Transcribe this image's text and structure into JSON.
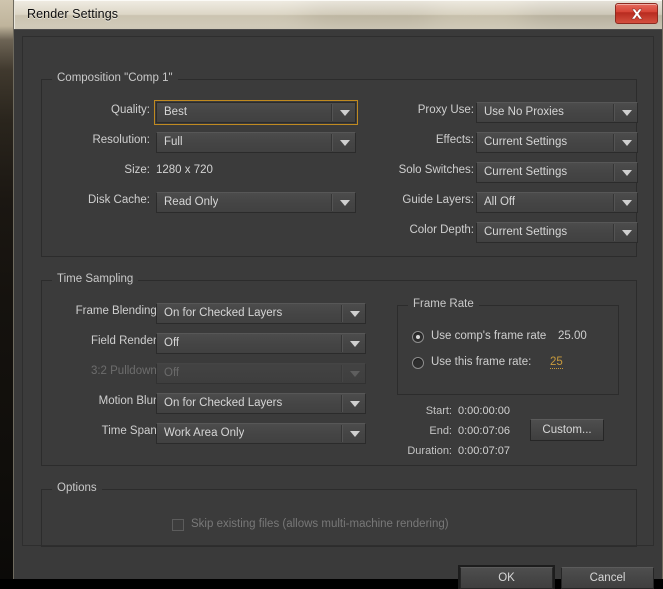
{
  "window": {
    "title": "Render Settings",
    "close_icon": "close-icon"
  },
  "composition": {
    "group_title": "Composition \"Comp 1\"",
    "left_fields": [
      {
        "label": "Quality:",
        "value": "Best",
        "focused": true,
        "disabled": false
      },
      {
        "label": "Resolution:",
        "value": "Full",
        "focused": false,
        "disabled": false
      },
      {
        "label": "Disk Cache:",
        "value": "Read Only",
        "focused": false,
        "disabled": false
      }
    ],
    "size": {
      "label": "Size:",
      "value": "1280 x 720"
    },
    "right_fields": [
      {
        "label": "Proxy Use:",
        "value": "Use No Proxies",
        "disabled": false
      },
      {
        "label": "Effects:",
        "value": "Current Settings",
        "disabled": false
      },
      {
        "label": "Solo Switches:",
        "value": "Current Settings",
        "disabled": false
      },
      {
        "label": "Guide Layers:",
        "value": "All Off",
        "disabled": false
      },
      {
        "label": "Color Depth:",
        "value": "Current Settings",
        "disabled": false
      }
    ]
  },
  "time_sampling": {
    "group_title": "Time Sampling",
    "fields": [
      {
        "label": "Frame Blending:",
        "value": "On for Checked Layers",
        "disabled": false
      },
      {
        "label": "Field Render:",
        "value": "Off",
        "disabled": false
      },
      {
        "label": "3:2 Pulldown:",
        "value": "Off",
        "disabled": true
      },
      {
        "label": "Motion Blur:",
        "value": "On for Checked Layers",
        "disabled": false
      },
      {
        "label": "Time Span:",
        "value": "Work Area Only",
        "disabled": false
      }
    ]
  },
  "frame_rate": {
    "group_title": "Frame Rate",
    "use_comp": {
      "label": "Use comp's frame rate",
      "value": "25.00",
      "selected": true
    },
    "use_this": {
      "label": "Use this frame rate:",
      "value": "25",
      "selected": false
    }
  },
  "time_info": {
    "start_label": "Start:",
    "start_value": "0:00:00:00",
    "end_label": "End:",
    "end_value": "0:00:07:06",
    "duration_label": "Duration:",
    "duration_value": "0:00:07:07",
    "custom_button": "Custom..."
  },
  "options": {
    "group_title": "Options",
    "skip_existing": {
      "label": "Skip existing files (allows multi-machine rendering)",
      "checked": false,
      "disabled": true
    }
  },
  "footer": {
    "ok": "OK",
    "cancel": "Cancel"
  },
  "colors": {
    "panel_bg": "#3b3b3b",
    "focus_accent": "#c08a20",
    "hot_text": "#c89a3c",
    "close_red": "#d64436"
  }
}
